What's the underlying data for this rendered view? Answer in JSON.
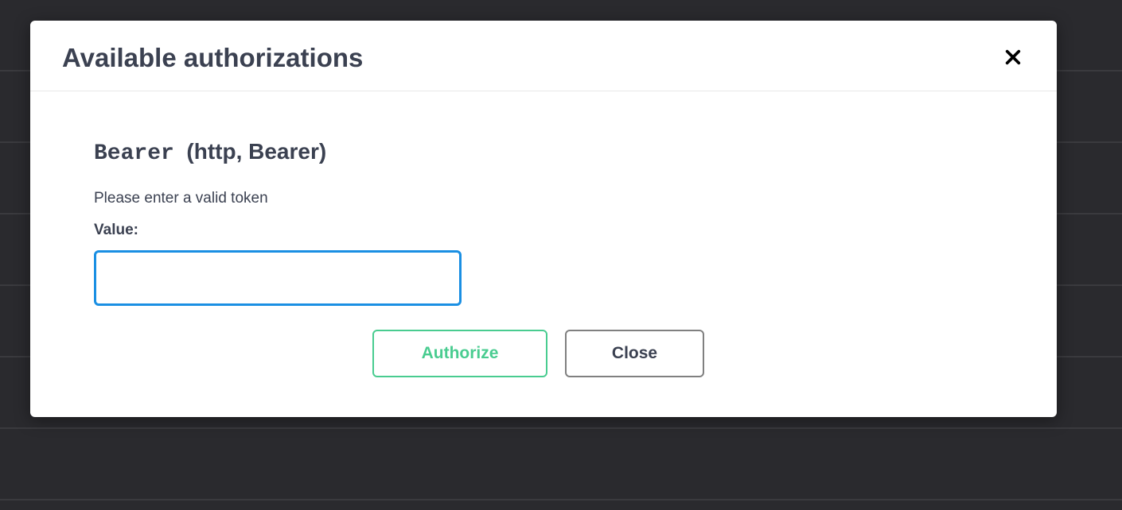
{
  "modal": {
    "title": "Available authorizations"
  },
  "auth": {
    "scheme_name": "Bearer",
    "scheme_details": "(http, Bearer)",
    "description": "Please enter a valid token",
    "field_label": "Value:",
    "token_value": ""
  },
  "buttons": {
    "authorize": "Authorize",
    "close": "Close"
  }
}
